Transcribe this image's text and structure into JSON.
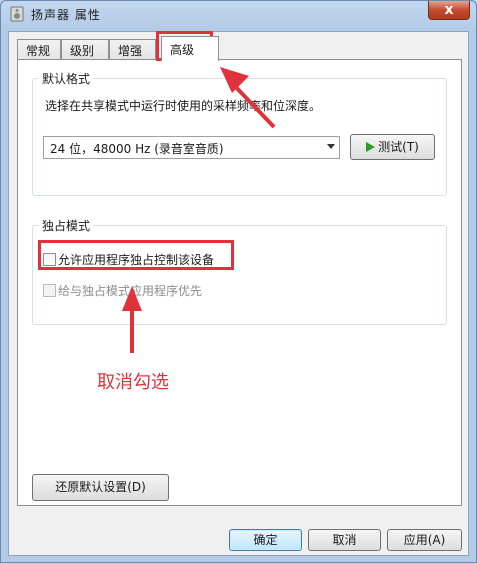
{
  "window": {
    "title": "扬声器 属性",
    "close_label": "x"
  },
  "tabs": [
    {
      "label": "常规",
      "active": false
    },
    {
      "label": "级别",
      "active": false
    },
    {
      "label": "增强",
      "active": false
    },
    {
      "label": "高级",
      "active": true
    }
  ],
  "default_format": {
    "group_label": "默认格式",
    "description": "选择在共享模式中运行时使用的采样频率和位深度。",
    "selected_format": "24 位，48000 Hz (录音室音质)",
    "test_button": "测试(T)"
  },
  "exclusive_mode": {
    "group_label": "独占模式",
    "allow_exclusive": {
      "label": "允许应用程序独占控制该设备",
      "checked": false
    },
    "give_priority": {
      "label": "给与独占模式应用程序优先",
      "checked": false,
      "enabled": false
    }
  },
  "restore_defaults_button": "还原默认设置(D)",
  "footer": {
    "ok": "确定",
    "cancel": "取消",
    "apply": "应用(A)"
  },
  "annotation": {
    "text": "取消勾选",
    "color": "#e0323b"
  }
}
